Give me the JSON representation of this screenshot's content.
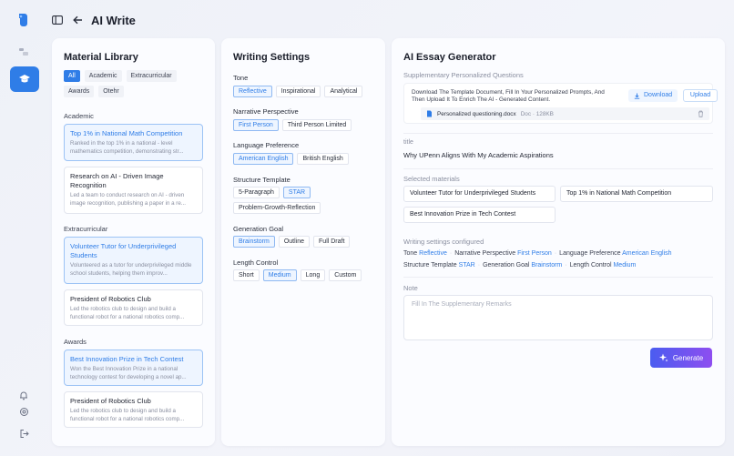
{
  "header": {
    "title": "AI Write"
  },
  "library": {
    "title": "Material Library",
    "tabs": [
      "All",
      "Academic",
      "Extracurricular",
      "Awards",
      "Otehr"
    ],
    "sections": [
      {
        "label": "Academic",
        "cards": [
          {
            "title": "Top 1% in National Math Competition",
            "desc": "Ranked in the top 1% in a national - level mathematics competition, demonstrating str...",
            "selected": true
          },
          {
            "title": "Research on AI - Driven Image Recognition",
            "desc": "Led a team to conduct research on AI - driven image recognition, publishing a paper in a re...",
            "selected": false
          }
        ]
      },
      {
        "label": "Extracurricular",
        "cards": [
          {
            "title": "Volunteer Tutor for Underprivileged Students",
            "desc": "Volunteered as a tutor for underprivileged middle school students, helping them improv...",
            "selected": true
          },
          {
            "title": "President of Robotics Club",
            "desc": "Led the robotics club to design and build a functional robot for a national robotics comp...",
            "selected": false
          }
        ]
      },
      {
        "label": "Awards",
        "cards": [
          {
            "title": "Best Innovation Prize in Tech Contest",
            "desc": "Won the Best Innovation Prize in a national technology contest for developing a novel ap...",
            "selected": true
          },
          {
            "title": "President of Robotics Club",
            "desc": "Led the robotics club to design and build a functional robot for a national robotics comp...",
            "selected": false
          }
        ]
      }
    ]
  },
  "settings": {
    "title": "Writing Settings",
    "groups": [
      {
        "label": "Tone",
        "options": [
          "Reflective",
          "Inspirational",
          "Analytical"
        ],
        "selected": "Reflective"
      },
      {
        "label": "Narrative Perspective",
        "options": [
          "First Person",
          "Third Person Limited"
        ],
        "selected": "First Person"
      },
      {
        "label": "Language Preference",
        "options": [
          "American English",
          "British English"
        ],
        "selected": "American English"
      },
      {
        "label": "Structure Template",
        "options": [
          "5-Paragraph",
          "STAR",
          "Problem-Growth-Reflection"
        ],
        "selected": "STAR"
      },
      {
        "label": "Generation Goal",
        "options": [
          "Brainstorm",
          "Outline",
          "Full Draft"
        ],
        "selected": "Brainstorm"
      },
      {
        "label": "Length Control",
        "options": [
          "Short",
          "Medium",
          "Long",
          "Custom"
        ],
        "selected": "Medium"
      }
    ]
  },
  "generator": {
    "title": "AI Essay Generator",
    "questions_label": "Supplementary Personalized Questions",
    "questions_text": "Download The Template Document, Fill In Your Personalized Prompts, And Then Upload It To Enrich The AI - Generated Content.",
    "download_label": "Download",
    "upload_label": "Upload",
    "file_name": "Personalized questioning.docx",
    "file_size": "Doc · 128KB",
    "title_label": "title",
    "title_value": "Why UPenn Aligns With My Academic Aspirations",
    "selected_label": "Selected materials",
    "selected_materials": [
      "Volunteer Tutor for Underprivileged Students",
      "Top 1% in National Math Competition",
      "Best Innovation Prize in Tech Contest"
    ],
    "configured_label": "Writing settings configured",
    "configured_line1": [
      {
        "k": "Tone",
        "v": "Reflective"
      },
      {
        "k": "Narrative Perspective",
        "v": "First Person"
      },
      {
        "k": "Language Preference",
        "v": "American English"
      }
    ],
    "configured_line2": [
      {
        "k": "Structure Template",
        "v": "STAR"
      },
      {
        "k": "Generation Goal",
        "v": "Brainstorm"
      },
      {
        "k": "Length Control",
        "v": "Medium"
      }
    ],
    "note_label": "Note",
    "note_placeholder": "Fill In The Supplementary Remarks",
    "generate_label": "Generate"
  }
}
